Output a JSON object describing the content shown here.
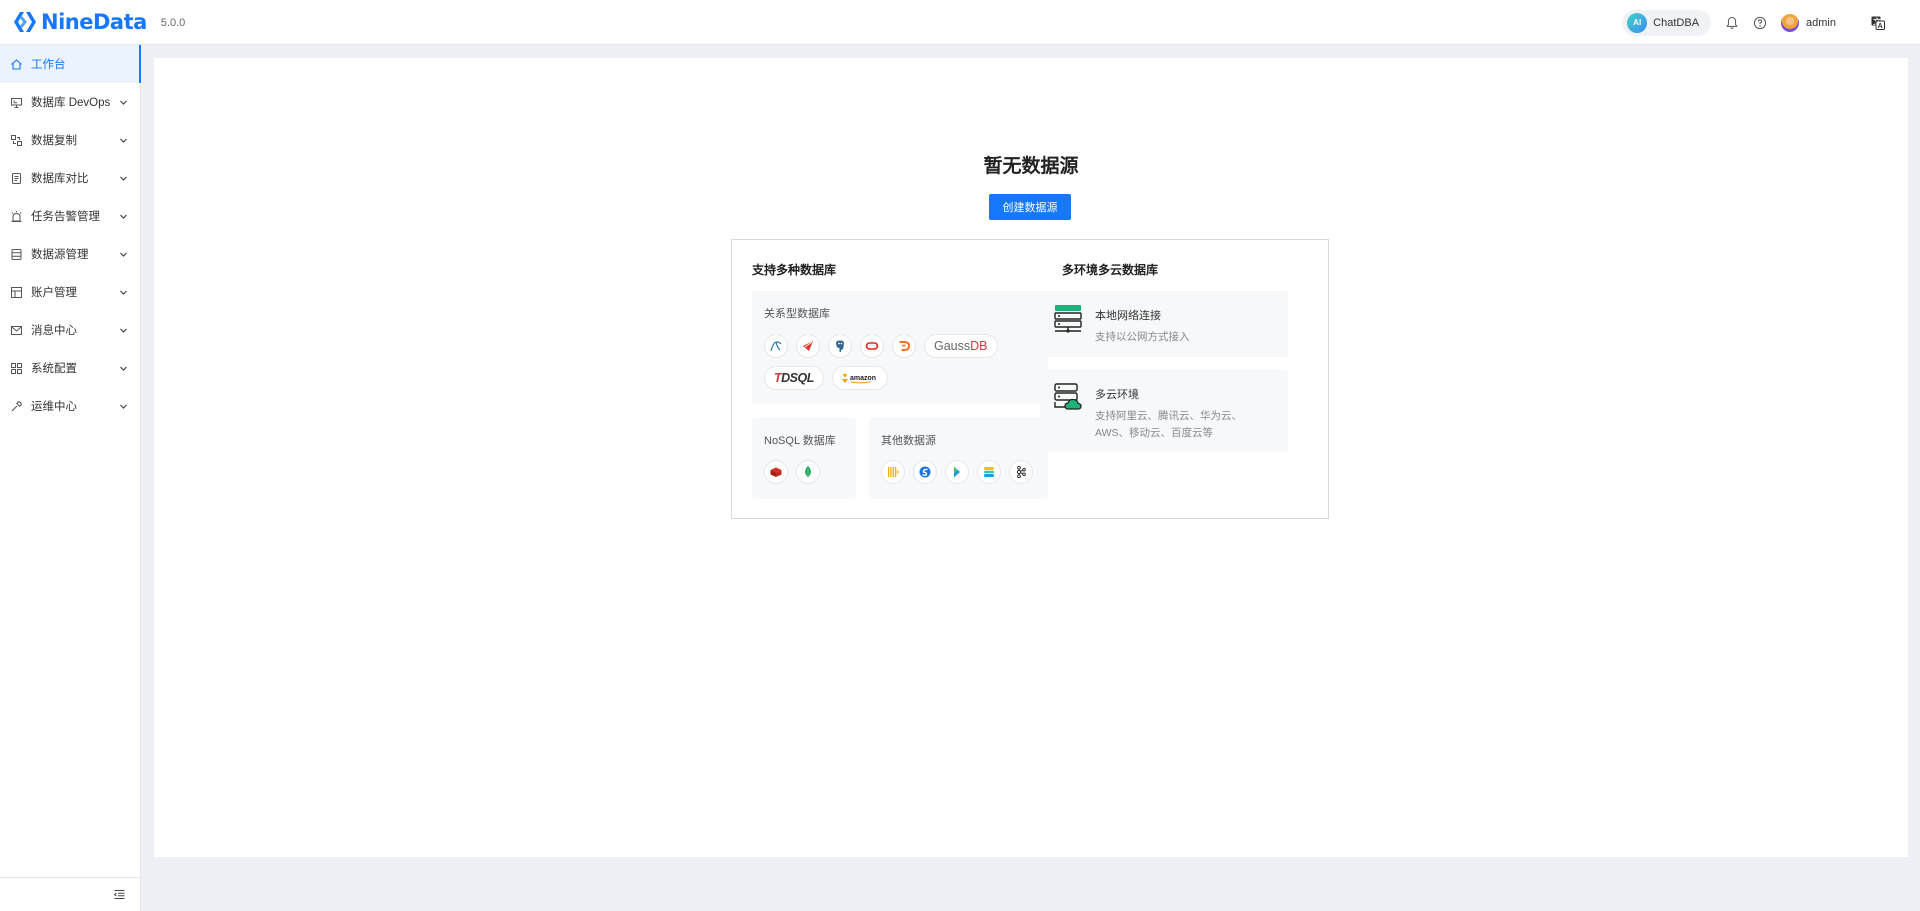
{
  "header": {
    "brand": "NineData",
    "version": "5.0.0",
    "chatdba_badge": "AI",
    "chatdba_label": "ChatDBA",
    "username": "admin"
  },
  "sidebar": {
    "items": [
      {
        "label": "工作台",
        "icon": "home-icon"
      },
      {
        "label": "数据库 DevOps",
        "icon": "monitor-icon"
      },
      {
        "label": "数据复制",
        "icon": "replicate-icon"
      },
      {
        "label": "数据库对比",
        "icon": "compare-icon"
      },
      {
        "label": "任务告警管理",
        "icon": "alarm-icon"
      },
      {
        "label": "数据源管理",
        "icon": "datasource-icon"
      },
      {
        "label": "账户管理",
        "icon": "account-icon"
      },
      {
        "label": "消息中心",
        "icon": "mail-icon"
      },
      {
        "label": "系统配置",
        "icon": "grid-icon"
      },
      {
        "label": "运维中心",
        "icon": "wrench-icon"
      }
    ]
  },
  "main": {
    "empty_title": "暂无数据源",
    "create_button": "创建数据源",
    "supported": {
      "title": "支持多种数据库",
      "relational_title": "关系型数据库",
      "relational": [
        "MySQL",
        "SQL Server",
        "PostgreSQL",
        "Oracle",
        "Doris",
        "GaussDB",
        "TDSQL",
        "Amazon Aurora"
      ],
      "gaussdb_prefix": "Gauss",
      "gaussdb_suffix": "DB",
      "tdsql_prefix": "T",
      "tdsql_suffix": "DSQL",
      "amazon_text": "amazon",
      "nosql_title": "NoSQL 数据库",
      "nosql": [
        "Redis",
        "MongoDB"
      ],
      "other_title": "其他数据源",
      "other": [
        "ClickHouse",
        "SelectDB",
        "StarRocks",
        "Elasticsearch",
        "Kafka"
      ]
    },
    "env": {
      "title": "多环境多云数据库",
      "items": [
        {
          "title": "本地网络连接",
          "desc": "支持以公网方式接入"
        },
        {
          "title": "多云环境",
          "desc": "支持阿里云、腾讯云、华为云、AWS、移动云、百度云等"
        }
      ]
    }
  },
  "colors": {
    "accent": "#1677ff",
    "active_bg": "#eaf3ff",
    "page_bg": "#eef0f5"
  }
}
